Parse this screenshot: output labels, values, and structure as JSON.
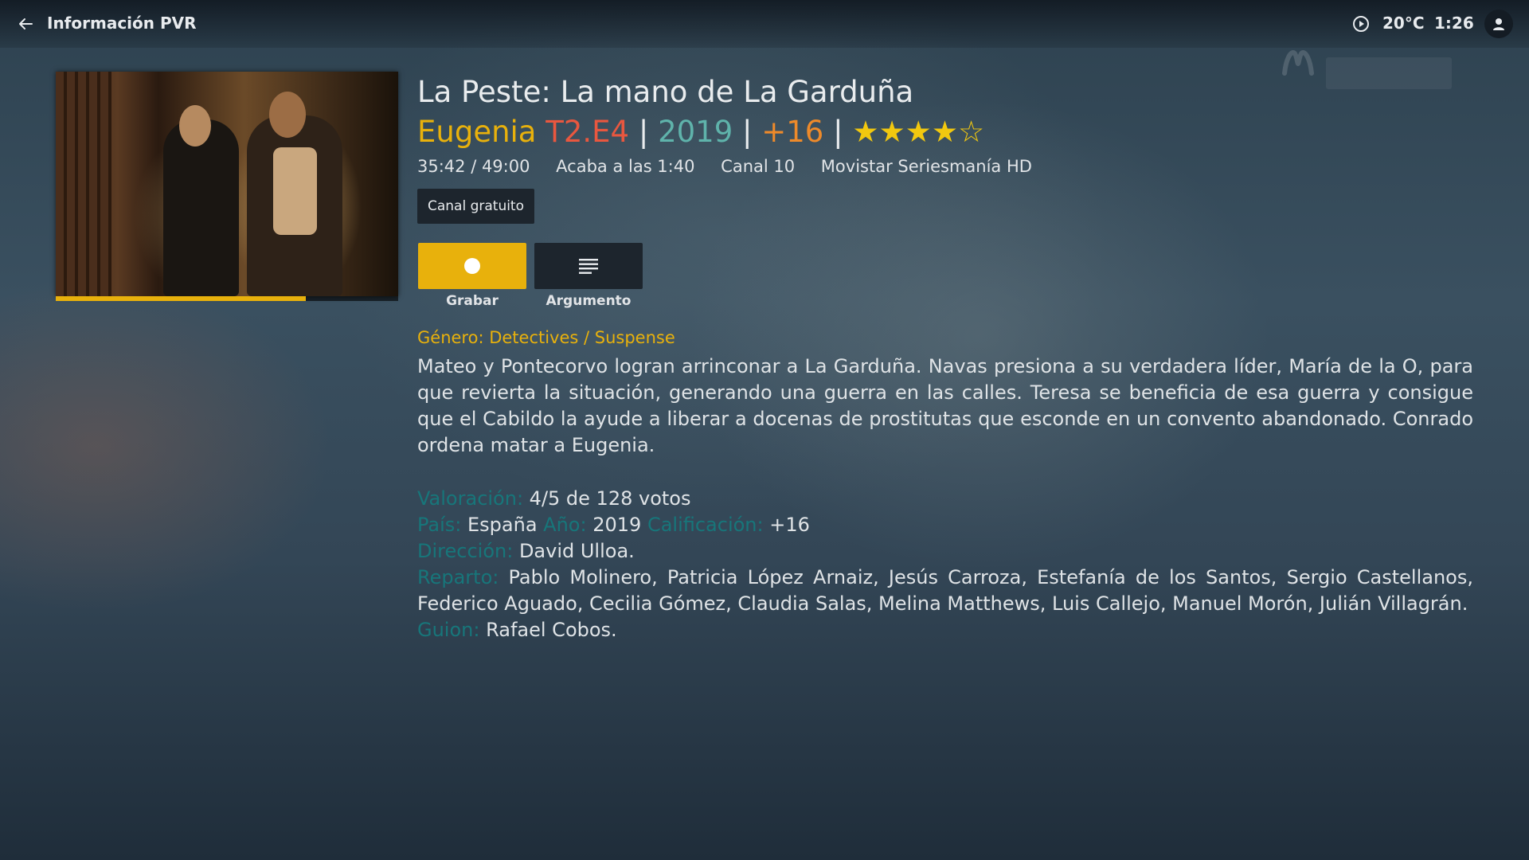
{
  "header": {
    "title": "Información PVR",
    "temperature": "20°C",
    "time": "1:26"
  },
  "poster": {
    "progress": 0.73
  },
  "program": {
    "title": "La Peste: La mano de La Garduña",
    "episode_name": "Eugenia",
    "episode_code": "T2.E4",
    "separator": "|",
    "year": "2019",
    "age_rating": "+16",
    "stars_display": "★★★★☆",
    "elapsed": "35:42 / 49:00",
    "ends_at": "Acaba a las 1:40",
    "channel_number": "Canal 10",
    "channel_name": "Movistar Seriesmanía HD",
    "badge": "Canal gratuito"
  },
  "actions": {
    "record_label": "Grabar",
    "plot_label": "Argumento"
  },
  "details": {
    "genre": "Género: Detectives / Suspense",
    "plot": "Mateo y Pontecorvo logran arrinconar a La Garduña. Navas presiona a su verdadera líder, María de la O, para que revierta la situación, generando una guerra en las calles. Teresa se beneficia de esa guerra y consigue que el Cabildo la ayude a liberar a docenas de prostitutas que esconde en un convento abandonado. Conrado ordena matar a Eugenia.",
    "rating_label": "Valoración:",
    "rating_value": "4/5 de 128 votos",
    "country_label": "País:",
    "country_value": "España",
    "year_label": "Año:",
    "year_value": "2019",
    "classification_label": "Calificación:",
    "classification_value": "+16",
    "director_label": "Dirección:",
    "director_value": "David Ulloa.",
    "cast_label": "Reparto:",
    "cast_value": "Pablo Molinero, Patricia López Arnaiz, Jesús Carroza, Estefanía de los Santos, Sergio Castellanos, Federico Aguado, Cecilia Gómez, Claudia Salas, Melina Matthews, Luis Callejo, Manuel Morón, Julián Villagrán.",
    "writer_label": "Guion:",
    "writer_value": "Rafael Cobos."
  },
  "colors": {
    "accent": "#e8b10c",
    "episode_code": "#e9573f",
    "year": "#5fb3ab",
    "age": "#ee8a2a",
    "detail_label": "#17767a"
  },
  "icons": {
    "back": "arrow-left-icon",
    "clock": "play-circle-icon",
    "profile": "user-icon",
    "record": "record-dot-icon",
    "plot": "text-lines-icon"
  }
}
